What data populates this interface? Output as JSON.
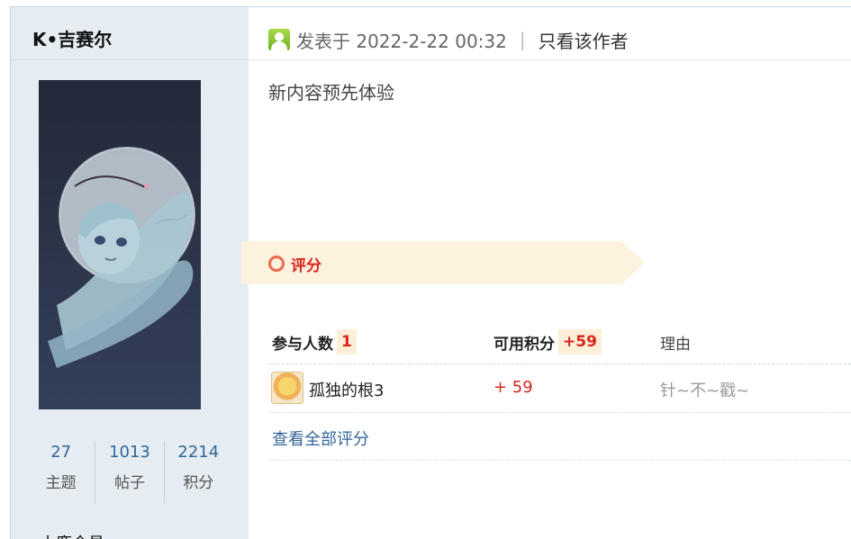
{
  "author": {
    "name": "K•吉赛尔",
    "stats": [
      {
        "value": "27",
        "label": "主题"
      },
      {
        "value": "1013",
        "label": "帖子"
      },
      {
        "value": "2214",
        "label": "积分"
      }
    ],
    "level": "小鹿会员"
  },
  "post": {
    "posted_at": "发表于 2022-2-22 00:32",
    "separator": "|",
    "only_author_link": "只看该作者",
    "content": "新内容预先体验"
  },
  "rating": {
    "title": "评分",
    "participants_label": "参与人数",
    "participants_count": "1",
    "points_label": "可用积分",
    "points_total": "+59",
    "reason_label": "理由",
    "entries": [
      {
        "user": "孤独的根3",
        "score": "+ 59",
        "reason": "针~不~戳~"
      }
    ],
    "view_all_link": "查看全部评分"
  },
  "colors": {
    "sidebar_bg": "#e5edf2",
    "link": "#336699",
    "accent_red": "#d8231b",
    "banner_bg": "#fdf2dd"
  }
}
